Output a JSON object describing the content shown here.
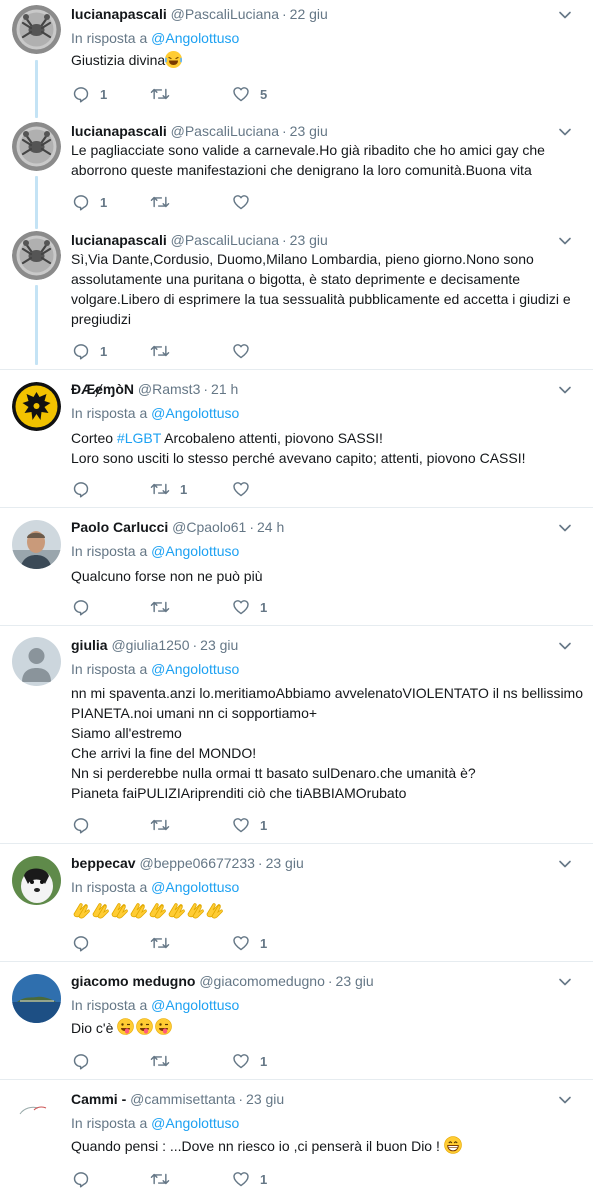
{
  "reply_prefix": "In risposta a",
  "tweets": [
    {
      "name": "lucianapascali",
      "handle": "@PascaliLuciana",
      "time": "22 giu",
      "reply_to": "@Angolottuso",
      "lines": [
        "Giustizia divina"
      ],
      "replies": "1",
      "retweets": "",
      "likes": "5"
    },
    {
      "name": "lucianapascali",
      "handle": "@PascaliLuciana",
      "time": "23 giu",
      "reply_to": "",
      "lines": [
        "Le pagliacciate sono valide a carnevale.Ho già ribadito che ho amici gay che",
        "aborrono queste manifestazioni che denigrano la loro comunità.Buona vita"
      ],
      "replies": "1",
      "retweets": "",
      "likes": ""
    },
    {
      "name": "lucianapascali",
      "handle": "@PascaliLuciana",
      "time": "23 giu",
      "reply_to": "",
      "lines": [
        "Sì,Via Dante,Cordusio, Duomo,Milano Lombardia, pieno giorno.Nono sono",
        "assolutamente una puritana o bigotta, è stato deprimente e decisamente",
        "volgare.Libero di esprimere la tua sessualità pubblicamente ed accetta i giudizi e",
        "pregiudizi"
      ],
      "replies": "1",
      "retweets": "",
      "likes": ""
    },
    {
      "name": "ĐÆ̷ɇɱòN",
      "handle": "@Ramst3",
      "time": "21 h",
      "reply_to": "@Angolottuso",
      "line1_pre": "Corteo ",
      "line1_tag": "#LGBT",
      "line1_post": " Arcobaleno attenti, piovono SASSI!",
      "line2": "Loro sono usciti lo stesso perché avevano capito; attenti, piovono CASSI!",
      "replies": "",
      "retweets": "1",
      "likes": ""
    },
    {
      "name": "Paolo Carlucci",
      "handle": "@Cpaolo61",
      "time": "24 h",
      "reply_to": "@Angolottuso",
      "lines": [
        "Qualcuno forse non ne può più"
      ],
      "replies": "",
      "retweets": "",
      "likes": "1"
    },
    {
      "name": "giulia",
      "handle": "@giulia1250",
      "time": "23 giu",
      "reply_to": "@Angolottuso",
      "lines": [
        "nn mi spaventa.anzi lo.meritiamoAbbiamo avvelenatoVIOLENTATO il ns bellissimo",
        "PIANETA.noi umani nn ci sopportiamo+",
        "Siamo all'estremo",
        "Che arrivi la fine del MONDO!",
        "Nn si perderebbe nulla ormai tt basato sulDenaro.che umanità è?",
        "Pianeta faiPULIZIAriprenditi ciò che tiABBIAMOrubato"
      ],
      "replies": "",
      "retweets": "",
      "likes": "1"
    },
    {
      "name": "beppecav",
      "handle": "@beppe06677233",
      "time": "23 giu",
      "reply_to": "@Angolottuso",
      "lines": [
        ""
      ],
      "replies": "",
      "retweets": "",
      "likes": "1"
    },
    {
      "name": "giacomo medugno",
      "handle": "@giacomomedugno",
      "time": "23 giu",
      "reply_to": "@Angolottuso",
      "lines": [
        "Dio c'è "
      ],
      "replies": "",
      "retweets": "",
      "likes": "1"
    },
    {
      "name": "Cammi -",
      "handle": "@cammisettanta",
      "time": "23 giu",
      "reply_to": "@Angolottuso",
      "lines": [
        "Quando pensi : ...Dove nn riesco io ,ci penserà il buon Dio ! "
      ],
      "replies": "",
      "retweets": "",
      "likes": "1"
    }
  ],
  "colors": {
    "link": "#1da1f2",
    "muted": "#657786",
    "thread": "#c4e3f5",
    "divider": "#e6ecf0"
  }
}
